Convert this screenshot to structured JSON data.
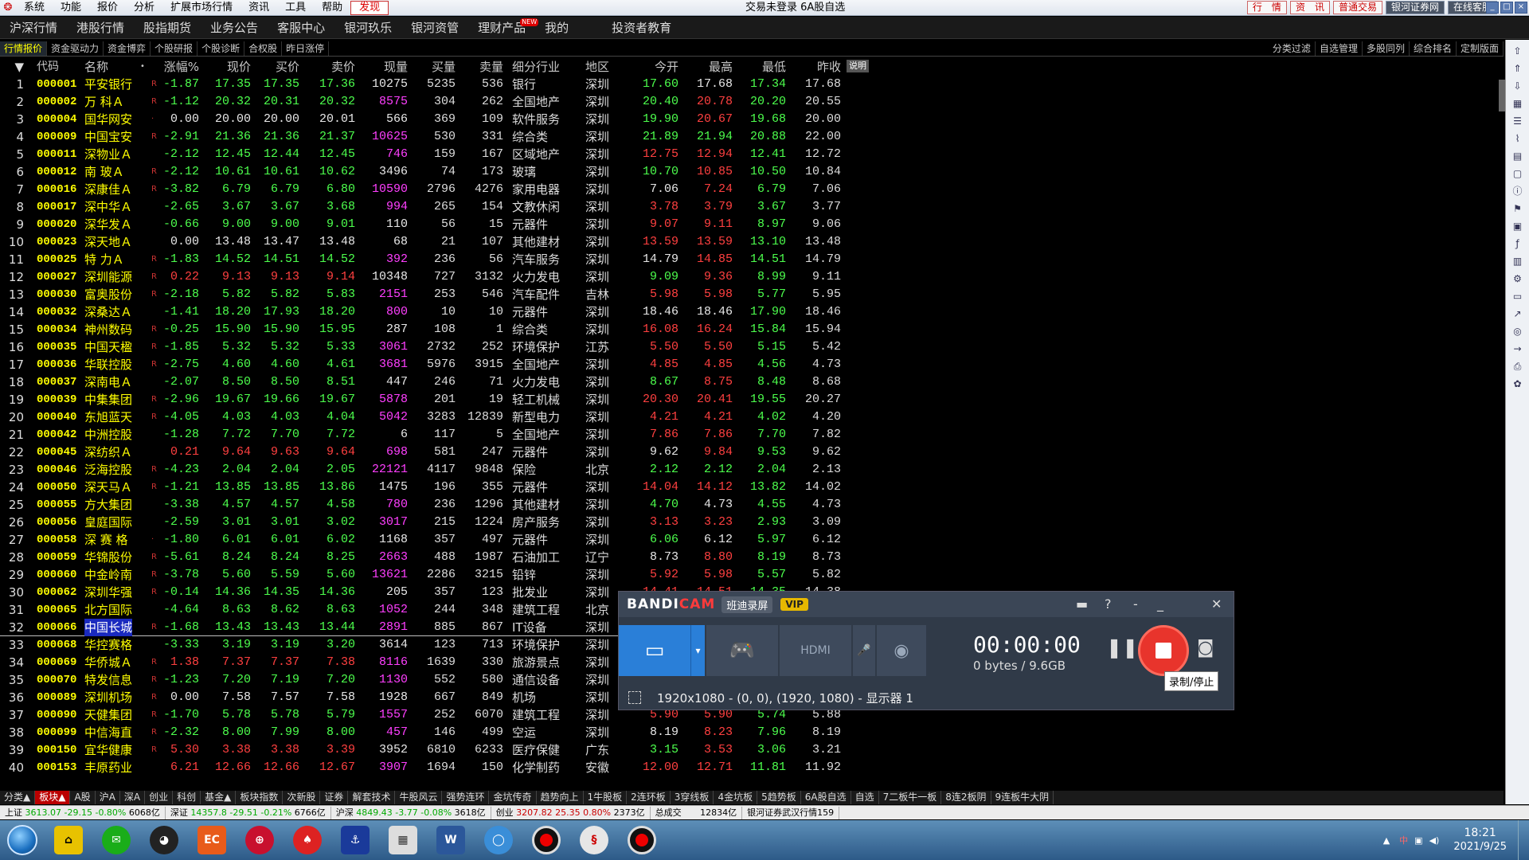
{
  "menubar": {
    "items": [
      "系统",
      "功能",
      "报价",
      "分析",
      "扩展市场行情",
      "资讯",
      "工具",
      "帮助",
      "发现"
    ],
    "title": "交易未登录  6A股自选",
    "right_buttons": [
      "行　情",
      "资　讯",
      "普通交易",
      "银河证券网",
      "在线客服"
    ]
  },
  "navbar": {
    "items": [
      "沪深行情",
      "港股行情",
      "股指期货",
      "业务公告",
      "客服中心",
      "银河玖乐",
      "银河资管",
      "理财产品",
      "我的",
      "投资者教育"
    ],
    "new_badge": "NEW"
  },
  "tabbar": {
    "left": [
      "行情报价",
      "资金驱动力",
      "资金博弈",
      "个股研报",
      "个股诊断",
      "合权股",
      "昨日涨停"
    ],
    "right": [
      "分类过滤",
      "自选管理",
      "多股同列",
      "综合排名",
      "定制版面"
    ]
  },
  "table": {
    "headers": {
      "code": "代码",
      "name": "名称",
      "dot": "•",
      "chg": "涨幅%",
      "price": "现价",
      "buy": "买价",
      "sell": "卖价",
      "vol": "现量",
      "bv": "买量",
      "sv": "卖量",
      "ind": "细分行业",
      "reg": "地区",
      "open": "今开",
      "high": "最高",
      "low": "最低",
      "prev": "昨收"
    },
    "explain": "说明",
    "rows": [
      [
        "1",
        "000001",
        "平安银行",
        "R",
        "-1.87",
        "17.35",
        "17.35",
        "17.36",
        "10275",
        "5235",
        "536",
        "银行",
        "深圳",
        "17.60",
        "17.68",
        "17.34",
        "17.68"
      ],
      [
        "2",
        "000002",
        "万 科Ａ",
        "R",
        "-1.12",
        "20.32",
        "20.31",
        "20.32",
        "8575",
        "304",
        "262",
        "全国地产",
        "深圳",
        "20.40",
        "20.78",
        "20.20",
        "20.55"
      ],
      [
        "3",
        "000004",
        "国华网安",
        "·",
        "0.00",
        "20.00",
        "20.00",
        "20.01",
        "566",
        "369",
        "109",
        "软件服务",
        "深圳",
        "19.90",
        "20.67",
        "19.68",
        "20.00"
      ],
      [
        "4",
        "000009",
        "中国宝安",
        "R",
        "-2.91",
        "21.36",
        "21.36",
        "21.37",
        "10625",
        "530",
        "331",
        "综合类",
        "深圳",
        "21.89",
        "21.94",
        "20.88",
        "22.00"
      ],
      [
        "5",
        "000011",
        "深物业Ａ",
        "",
        "-2.12",
        "12.45",
        "12.44",
        "12.45",
        "746",
        "159",
        "167",
        "区域地产",
        "深圳",
        "12.75",
        "12.94",
        "12.41",
        "12.72"
      ],
      [
        "6",
        "000012",
        "南 玻Ａ",
        "R",
        "-2.12",
        "10.61",
        "10.61",
        "10.62",
        "3496",
        "74",
        "173",
        "玻璃",
        "深圳",
        "10.70",
        "10.85",
        "10.50",
        "10.84"
      ],
      [
        "7",
        "000016",
        "深康佳Ａ",
        "R",
        "-3.82",
        "6.79",
        "6.79",
        "6.80",
        "10590",
        "2796",
        "4276",
        "家用电器",
        "深圳",
        "7.06",
        "7.24",
        "6.79",
        "7.06"
      ],
      [
        "8",
        "000017",
        "深中华Ａ",
        "",
        "-2.65",
        "3.67",
        "3.67",
        "3.68",
        "994",
        "265",
        "154",
        "文教休闲",
        "深圳",
        "3.78",
        "3.79",
        "3.67",
        "3.77"
      ],
      [
        "9",
        "000020",
        "深华发Ａ",
        "",
        "-0.66",
        "9.00",
        "9.00",
        "9.01",
        "110",
        "56",
        "15",
        "元器件",
        "深圳",
        "9.07",
        "9.11",
        "8.97",
        "9.06"
      ],
      [
        "10",
        "000023",
        "深天地Ａ",
        "",
        "0.00",
        "13.48",
        "13.47",
        "13.48",
        "68",
        "21",
        "107",
        "其他建材",
        "深圳",
        "13.59",
        "13.59",
        "13.10",
        "13.48"
      ],
      [
        "11",
        "000025",
        "特 力Ａ",
        "R",
        "-1.83",
        "14.52",
        "14.51",
        "14.52",
        "392",
        "236",
        "56",
        "汽车服务",
        "深圳",
        "14.79",
        "14.85",
        "14.51",
        "14.79"
      ],
      [
        "12",
        "000027",
        "深圳能源",
        "R",
        "0.22",
        "9.13",
        "9.13",
        "9.14",
        "10348",
        "727",
        "3132",
        "火力发电",
        "深圳",
        "9.09",
        "9.36",
        "8.99",
        "9.11"
      ],
      [
        "13",
        "000030",
        "富奥股份",
        "R",
        "-2.18",
        "5.82",
        "5.82",
        "5.83",
        "2151",
        "253",
        "546",
        "汽车配件",
        "吉林",
        "5.98",
        "5.98",
        "5.77",
        "5.95"
      ],
      [
        "14",
        "000032",
        "深桑达Ａ",
        "",
        "-1.41",
        "18.20",
        "17.93",
        "18.20",
        "800",
        "10",
        "10",
        "元器件",
        "深圳",
        "18.46",
        "18.46",
        "17.90",
        "18.46"
      ],
      [
        "15",
        "000034",
        "神州数码",
        "R",
        "-0.25",
        "15.90",
        "15.90",
        "15.95",
        "287",
        "108",
        "1",
        "综合类",
        "深圳",
        "16.08",
        "16.24",
        "15.84",
        "15.94"
      ],
      [
        "16",
        "000035",
        "中国天楹",
        "R",
        "-1.85",
        "5.32",
        "5.32",
        "5.33",
        "3061",
        "2732",
        "252",
        "环境保护",
        "江苏",
        "5.50",
        "5.50",
        "5.15",
        "5.42"
      ],
      [
        "17",
        "000036",
        "华联控股",
        "R",
        "-2.75",
        "4.60",
        "4.60",
        "4.61",
        "3681",
        "5976",
        "3915",
        "全国地产",
        "深圳",
        "4.85",
        "4.85",
        "4.56",
        "4.73"
      ],
      [
        "18",
        "000037",
        "深南电Ａ",
        "",
        "-2.07",
        "8.50",
        "8.50",
        "8.51",
        "447",
        "246",
        "71",
        "火力发电",
        "深圳",
        "8.67",
        "8.75",
        "8.48",
        "8.68"
      ],
      [
        "19",
        "000039",
        "中集集团",
        "R",
        "-2.96",
        "19.67",
        "19.66",
        "19.67",
        "5878",
        "201",
        "19",
        "轻工机械",
        "深圳",
        "20.30",
        "20.41",
        "19.55",
        "20.27"
      ],
      [
        "20",
        "000040",
        "东旭蓝天",
        "R",
        "-4.05",
        "4.03",
        "4.03",
        "4.04",
        "5042",
        "3283",
        "12839",
        "新型电力",
        "深圳",
        "4.21",
        "4.21",
        "4.02",
        "4.20"
      ],
      [
        "21",
        "000042",
        "中洲控股",
        "",
        "-1.28",
        "7.72",
        "7.70",
        "7.72",
        "6",
        "117",
        "5",
        "全国地产",
        "深圳",
        "7.86",
        "7.86",
        "7.70",
        "7.82"
      ],
      [
        "22",
        "000045",
        "深纺织Ａ",
        "",
        "0.21",
        "9.64",
        "9.63",
        "9.64",
        "698",
        "581",
        "247",
        "元器件",
        "深圳",
        "9.62",
        "9.84",
        "9.53",
        "9.62"
      ],
      [
        "23",
        "000046",
        "泛海控股",
        "R",
        "-4.23",
        "2.04",
        "2.04",
        "2.05",
        "22121",
        "4117",
        "9848",
        "保险",
        "北京",
        "2.12",
        "2.12",
        "2.04",
        "2.13"
      ],
      [
        "24",
        "000050",
        "深天马Ａ",
        "R",
        "-1.21",
        "13.85",
        "13.85",
        "13.86",
        "1475",
        "196",
        "355",
        "元器件",
        "深圳",
        "14.04",
        "14.12",
        "13.82",
        "14.02"
      ],
      [
        "25",
        "000055",
        "方大集团",
        "",
        "-3.38",
        "4.57",
        "4.57",
        "4.58",
        "780",
        "236",
        "1296",
        "其他建材",
        "深圳",
        "4.70",
        "4.73",
        "4.55",
        "4.73"
      ],
      [
        "26",
        "000056",
        "皇庭国际",
        "",
        "-2.59",
        "3.01",
        "3.01",
        "3.02",
        "3017",
        "215",
        "1224",
        "房产服务",
        "深圳",
        "3.13",
        "3.23",
        "2.93",
        "3.09"
      ],
      [
        "27",
        "000058",
        "深 赛 格",
        "·",
        "-1.80",
        "6.01",
        "6.01",
        "6.02",
        "1168",
        "357",
        "497",
        "元器件",
        "深圳",
        "6.06",
        "6.12",
        "5.97",
        "6.12"
      ],
      [
        "28",
        "000059",
        "华锦股份",
        "R",
        "-5.61",
        "8.24",
        "8.24",
        "8.25",
        "2663",
        "488",
        "1987",
        "石油加工",
        "辽宁",
        "8.73",
        "8.80",
        "8.19",
        "8.73"
      ],
      [
        "29",
        "000060",
        "中金岭南",
        "R",
        "-3.78",
        "5.60",
        "5.59",
        "5.60",
        "13621",
        "2286",
        "3215",
        "铅锌",
        "深圳",
        "5.92",
        "5.98",
        "5.57",
        "5.82"
      ],
      [
        "30",
        "000062",
        "深圳华强",
        "R",
        "-0.14",
        "14.36",
        "14.35",
        "14.36",
        "205",
        "357",
        "123",
        "批发业",
        "深圳",
        "14.41",
        "14.51",
        "14.35",
        "14.38"
      ],
      [
        "31",
        "000065",
        "北方国际",
        "",
        "-4.64",
        "8.63",
        "8.62",
        "8.63",
        "1052",
        "244",
        "348",
        "建筑工程",
        "北京",
        "",
        "",
        "",
        ""
      ],
      [
        "32",
        "000066",
        "中国长城",
        "R",
        "-1.68",
        "13.43",
        "13.43",
        "13.44",
        "2891",
        "885",
        "867",
        "IT设备",
        "深圳",
        "",
        "",
        "",
        ""
      ],
      [
        "33",
        "000068",
        "华控赛格",
        "",
        "-3.33",
        "3.19",
        "3.19",
        "3.20",
        "3614",
        "123",
        "713",
        "环境保护",
        "深圳",
        "",
        "",
        "",
        ""
      ],
      [
        "34",
        "000069",
        "华侨城Ａ",
        "R",
        "1.38",
        "7.37",
        "7.37",
        "7.38",
        "8116",
        "1639",
        "330",
        "旅游景点",
        "深圳",
        "",
        "",
        "",
        ""
      ],
      [
        "35",
        "000070",
        "特发信息",
        "R",
        "-1.23",
        "7.20",
        "7.19",
        "7.20",
        "1130",
        "552",
        "580",
        "通信设备",
        "深圳",
        "",
        "",
        "",
        ""
      ],
      [
        "36",
        "000089",
        "深圳机场",
        "R",
        "0.00",
        "7.58",
        "7.57",
        "7.58",
        "1928",
        "667",
        "849",
        "机场",
        "深圳",
        "",
        "",
        "",
        ""
      ],
      [
        "37",
        "000090",
        "天健集团",
        "R",
        "-1.70",
        "5.78",
        "5.78",
        "5.79",
        "1557",
        "252",
        "6070",
        "建筑工程",
        "深圳",
        "5.90",
        "5.90",
        "5.74",
        "5.88"
      ],
      [
        "38",
        "000099",
        "中信海直",
        "R",
        "-2.32",
        "8.00",
        "7.99",
        "8.00",
        "457",
        "146",
        "499",
        "空运",
        "深圳",
        "8.19",
        "8.23",
        "7.96",
        "8.19"
      ],
      [
        "39",
        "000150",
        "宜华健康",
        "R",
        "5.30",
        "3.38",
        "3.38",
        "3.39",
        "3952",
        "6810",
        "6233",
        "医疗保健",
        "广东",
        "3.15",
        "3.53",
        "3.06",
        "3.21"
      ],
      [
        "40",
        "000153",
        "丰原药业",
        "",
        "6.21",
        "12.66",
        "12.66",
        "12.67",
        "3907",
        "1694",
        "150",
        "化学制药",
        "安徽",
        "12.00",
        "12.71",
        "11.81",
        "11.92"
      ]
    ]
  },
  "blockbar": [
    "分类▲",
    "板块▲",
    "A股",
    "沪A",
    "深A",
    "创业",
    "科创",
    "基金▲",
    "板块指数",
    "次新股",
    "证券",
    "解套技术",
    "牛股风云",
    "强势连环",
    "金坑传奇",
    "趋势向上",
    "1牛股板",
    "2连环板",
    "3穿线板",
    "4金坑板",
    "5趋势板",
    "6A股自选",
    "自选",
    "7二板牛一板",
    "8连2板阴",
    "9连板牛大阴"
  ],
  "statusbar": {
    "sh": {
      "name": "上证",
      "val": "3613.07",
      "chg": "-29.15",
      "pct": "-0.80%",
      "amt": "6068亿"
    },
    "sz": {
      "name": "深证",
      "val": "14357.8",
      "chg": "-29.51",
      "pct": "-0.21%",
      "amt": "6766亿"
    },
    "hs": {
      "name": "沪深",
      "val": "4849.43",
      "chg": "-3.77",
      "pct": "-0.08%",
      "amt": "3618亿"
    },
    "cy": {
      "name": "创业",
      "val": "3207.82",
      "chg": "25.35",
      "pct": "0.80%",
      "amt": "2373亿"
    },
    "total_label": "总成交",
    "total": "12834亿",
    "news": "银河证券武汉行情159"
  },
  "bandicam": {
    "brand_a": "BANDI",
    "brand_b": "CAM",
    "cn": "班迪录屏",
    "vip": "VIP",
    "time": "00:00:00",
    "size": "0 bytes / 9.6GB",
    "region": "1920x1080 - (0, 0), (1920, 1080) - 显示器 1",
    "tooltip": "录制/停止"
  },
  "taskbar": {
    "time": "18:21",
    "date": "2021/9/25"
  },
  "colors": {
    "up": "#ff4040",
    "down": "#4dff4d",
    "code": "#ffff00",
    "rec": "#e8342c"
  }
}
